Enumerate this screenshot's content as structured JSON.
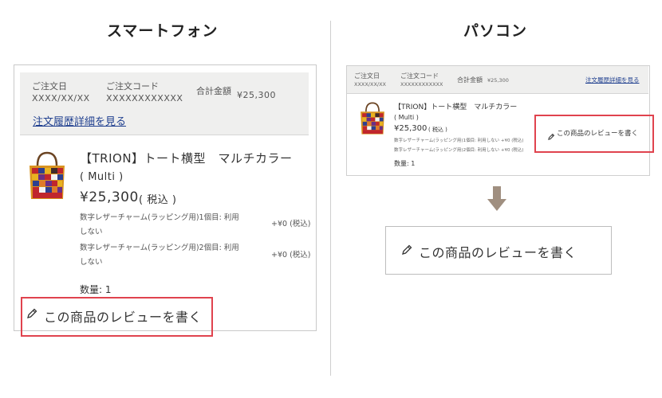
{
  "smartphone": {
    "title": "スマートフォン",
    "order_date_label": "ご注文日",
    "order_date_value": "XXXX/XX/XX",
    "order_code_label": "ご注文コード",
    "order_code_value": "XXXXXXXXXXXX",
    "total_label": "合計金額",
    "total_value": "¥25,300",
    "history_link": "注文履歴詳細を見る",
    "product_title": "【TRION】トート横型　マルチカラー",
    "product_color": "( Multi )",
    "price": "¥25,300",
    "price_tax": "( 税込 )",
    "options": [
      {
        "line1": "数字レザーチャーム(ラッピング用)1個目:  利用",
        "line2": "しない",
        "price": "+¥0 (税込)"
      },
      {
        "line1": "数字レザーチャーム(ラッピング用)2個目:  利用",
        "line2": "しない",
        "price": "+¥0 (税込)"
      }
    ],
    "quantity": "数量:  1",
    "review_label": "この商品のレビューを書く"
  },
  "pc": {
    "title": "パソコン",
    "order_date_label": "ご注文日",
    "order_date_value": "XXXX/XX/XX",
    "order_code_label": "ご注文コード",
    "order_code_value": "XXXXXXXXXXXX",
    "total_label": "合計金額",
    "total_value": "¥25,300",
    "history_link": "注文履歴詳細を見る",
    "product_title": "【TRION】トート横型　マルチカラー",
    "product_color": "( Multi )",
    "price": "¥25,300",
    "price_tax": "( 税込 )",
    "options": [
      "数字レザーチャーム(ラッピング用)1個目:  利用しない  +¥0 (税込)",
      "数字レザーチャーム(ラッピング用)2個目:  利用しない  +¥0 (税込)"
    ],
    "quantity": "数量:  1",
    "review_label": "この商品のレビューを書く"
  },
  "zoom": {
    "review_label": "この商品のレビューを書く"
  },
  "colors": {
    "highlight": "#e0434e",
    "header_bg": "#efefee",
    "link": "#1f3f8f",
    "arrow": "#a08f80"
  },
  "icons": [
    "pencil-icon",
    "tote-bag-image",
    "arrow-down-icon"
  ]
}
